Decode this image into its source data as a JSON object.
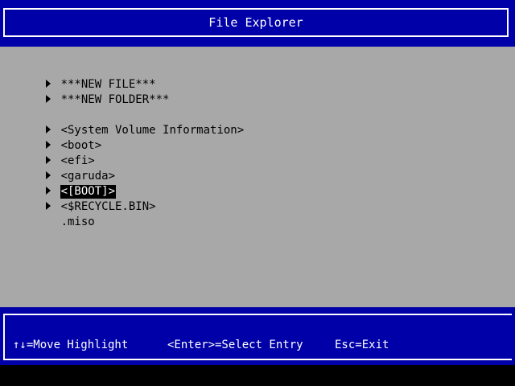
{
  "header": {
    "title": "File Explorer"
  },
  "entries": [
    {
      "label": "***NEW FILE***",
      "arrow": true,
      "selected": false
    },
    {
      "label": "***NEW FOLDER***",
      "arrow": true,
      "selected": false
    },
    {
      "label": "<System Volume Information>",
      "arrow": true,
      "selected": false
    },
    {
      "label": "<boot>",
      "arrow": true,
      "selected": false
    },
    {
      "label": "<efi>",
      "arrow": true,
      "selected": false
    },
    {
      "label": "<garuda>",
      "arrow": true,
      "selected": false
    },
    {
      "label": "<[BOOT]>",
      "arrow": true,
      "selected": true
    },
    {
      "label": "<$RECYCLE.BIN>",
      "arrow": true,
      "selected": false
    },
    {
      "label": ".miso",
      "arrow": false,
      "selected": false
    }
  ],
  "footer": {
    "move_hint": "↑↓=Move Highlight",
    "enter_hint": "<Enter>=Select Entry",
    "esc_hint": "Esc=Exit"
  },
  "colors": {
    "header_bg": "#0000a8",
    "body_bg": "#a8a8a8",
    "selection_bg": "#000000",
    "text_light": "#ffffff"
  }
}
